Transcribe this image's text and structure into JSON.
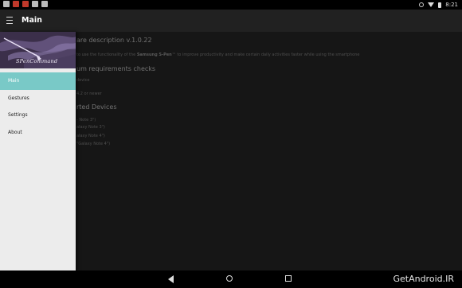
{
  "status_bar": {
    "left_icons": [
      "sb-icon-1",
      "sb-icon-2",
      "sb-icon-3",
      "sb-icon-4",
      "sb-icon-5"
    ],
    "time": "8:21"
  },
  "appbar": {
    "title": "Main"
  },
  "content": {
    "heading1": "are description v.1.0.22",
    "desc_pre": "to use the functionality of the ",
    "desc_bold": "Samsung S-Pen",
    "desc_post": "™ to improve productivity and make certain daily activities faster while using the smartphone",
    "heading2": "um requirements checks",
    "req1": "device",
    "req2": "4.2 or newer",
    "heading3": "rted Devices",
    "dev1": "- Note 3\")",
    "dev2": "alaxy Note 3\")",
    "dev3": "alaxy Note 4\")",
    "dev4": "\"Galaxy Note 4\")"
  },
  "drawer": {
    "brand": "SPenCommand",
    "items": [
      {
        "label": "Main",
        "active": true
      },
      {
        "label": "Gestures",
        "active": false
      },
      {
        "label": "Settings",
        "active": false
      },
      {
        "label": "About",
        "active": false
      }
    ]
  },
  "watermark": "GetAndroid.IR",
  "colors": {
    "accent": "#79c9c7",
    "appbar": "#212121",
    "drawer": "#ececec"
  }
}
